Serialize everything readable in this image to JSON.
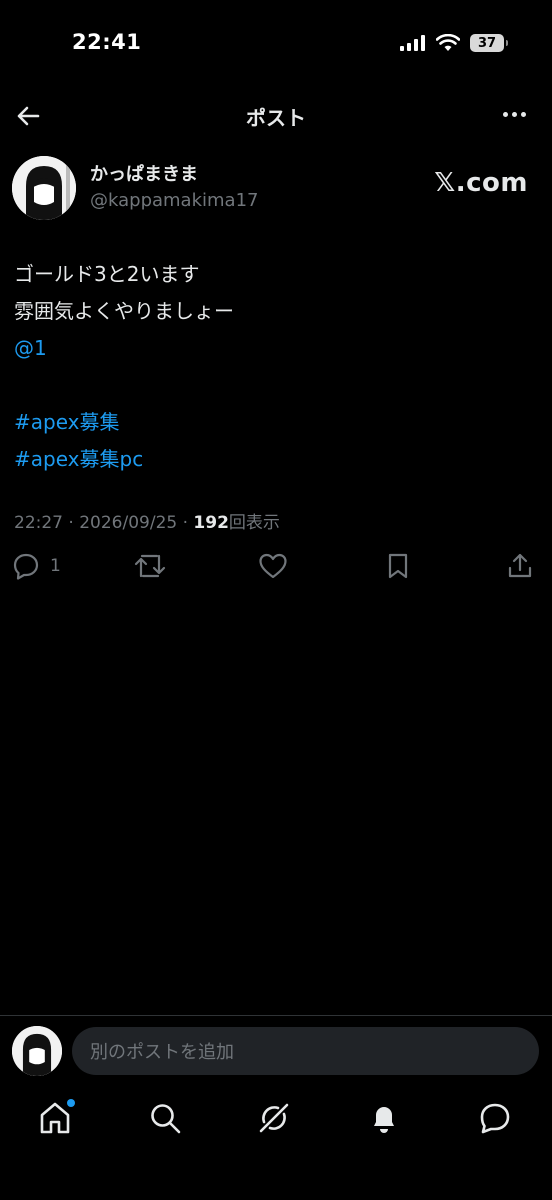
{
  "status_bar": {
    "time": "22:41",
    "battery": "37"
  },
  "header": {
    "title": "ポスト",
    "back_icon": "arrow-left-icon",
    "more_icon": "more-horizontal-icon"
  },
  "author": {
    "display_name": "かっぱまきま",
    "handle": "@kappamakima17",
    "watermark": "𝕏.com"
  },
  "post": {
    "lines": [
      {
        "text": "ゴールド3と2います",
        "type": "text"
      },
      {
        "text": "雰囲気よくやりましょー",
        "type": "text"
      },
      {
        "text": "@1",
        "type": "mention"
      },
      {
        "text": "",
        "type": "blank"
      },
      {
        "text": "#apex募集",
        "type": "hashtag"
      },
      {
        "text": "#apex募集pc",
        "type": "hashtag"
      }
    ],
    "time": "22:27",
    "date": "2026/09/25",
    "views_count": "192",
    "views_label": "回表示",
    "separator": "·"
  },
  "actions": {
    "reply_count": "1"
  },
  "reply_bar": {
    "placeholder": "別のポストを追加"
  },
  "nav": [
    "home-icon",
    "search-icon",
    "grok-icon",
    "notifications-icon",
    "messages-icon"
  ],
  "colors": {
    "accent": "#1d9bf0",
    "background": "#000000",
    "muted": "#71767b",
    "text": "#e7e9ea"
  }
}
